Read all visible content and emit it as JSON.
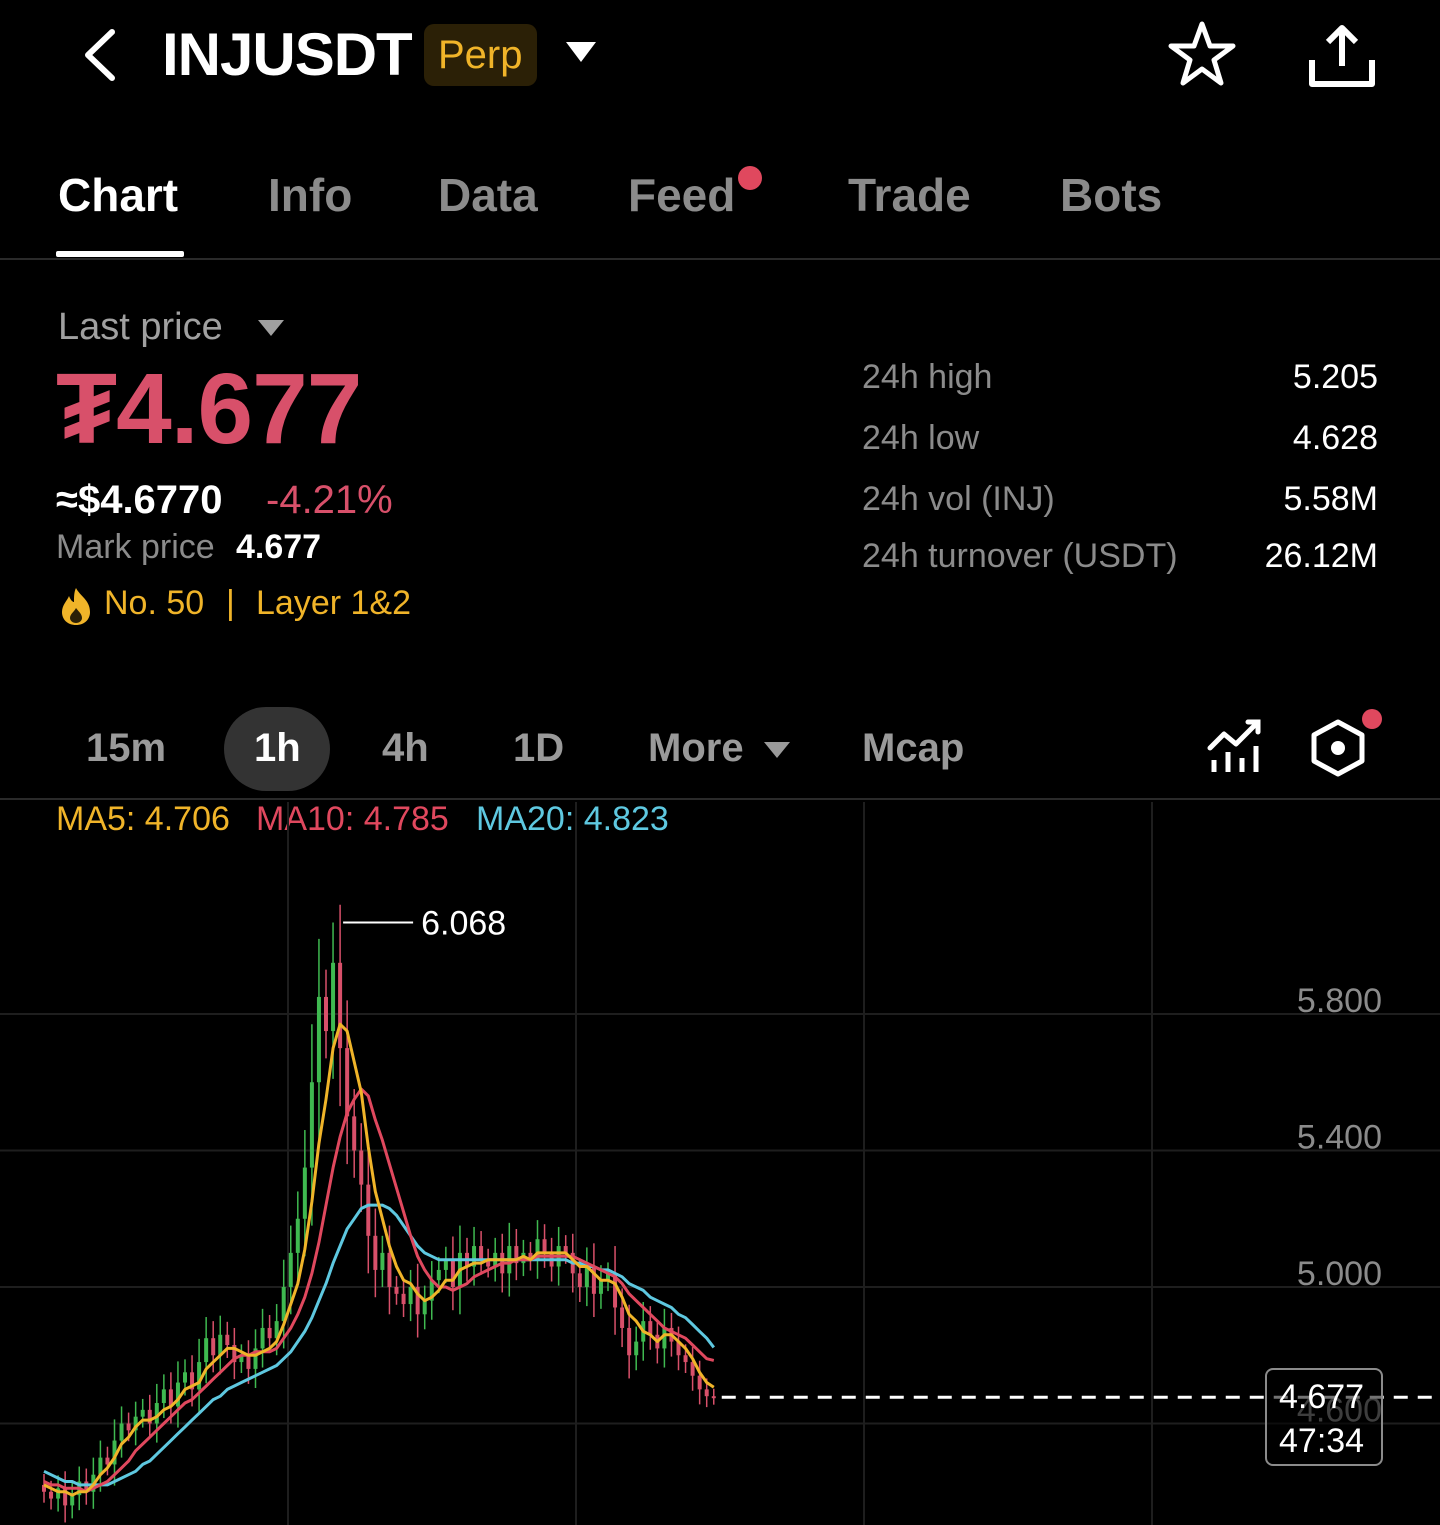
{
  "header": {
    "symbol": "INJUSDT",
    "badge": "Perp"
  },
  "tabs": [
    {
      "label": "Chart",
      "active": true
    },
    {
      "label": "Info"
    },
    {
      "label": "Data"
    },
    {
      "label": "Feed",
      "notification": true
    },
    {
      "label": "Trade"
    },
    {
      "label": "Bots"
    }
  ],
  "price": {
    "label": "Last price",
    "last": "₮4.677",
    "usd": "≈$4.6770",
    "change": "-4.21%",
    "mark_label": "Mark price",
    "mark_value": "4.677",
    "rank": "No. 50",
    "separator": "|",
    "sector": "Layer 1&2"
  },
  "stats": [
    {
      "label": "24h high",
      "value": "5.205"
    },
    {
      "label": "24h low",
      "value": "4.628"
    },
    {
      "label": "24h vol (INJ)",
      "value": "5.58M"
    },
    {
      "label": "24h turnover (USDT)",
      "value": "26.12M"
    }
  ],
  "intervals": [
    {
      "label": "15m"
    },
    {
      "label": "1h",
      "active": true
    },
    {
      "label": "4h"
    },
    {
      "label": "1D"
    },
    {
      "label": "More"
    },
    {
      "label": "Mcap"
    }
  ],
  "ma": {
    "ma5": "MA5: 4.706",
    "ma10": "MA10: 4.785",
    "ma20": "MA20: 4.823"
  },
  "colors": {
    "accent_red": "#d8506a",
    "accent_green": "#3fb950",
    "ma5": "#f0b429",
    "ma10": "#e0485e",
    "ma20": "#5ec8e0",
    "badge_bg": "#2b2006",
    "badge_fg": "#f0b429"
  },
  "chart_data": {
    "type": "candlestick",
    "y_ticks": [
      "5.800",
      "5.400",
      "5.000",
      "4.600"
    ],
    "high_label": "6.068",
    "current_price": "4.677",
    "countdown": "47:34",
    "close": [
      4.4,
      4.38,
      4.41,
      4.36,
      4.39,
      4.43,
      4.4,
      4.45,
      4.5,
      4.48,
      4.55,
      4.6,
      4.58,
      4.62,
      4.64,
      4.6,
      4.66,
      4.7,
      4.65,
      4.72,
      4.75,
      4.7,
      4.78,
      4.85,
      4.8,
      4.86,
      4.83,
      4.78,
      4.8,
      4.76,
      4.82,
      4.88,
      4.85,
      4.9,
      5.0,
      5.1,
      5.2,
      5.35,
      5.6,
      5.85,
      5.75,
      5.95,
      5.7,
      5.5,
      5.4,
      5.3,
      5.15,
      5.05,
      5.1,
      5.0,
      4.98,
      4.95,
      5.0,
      4.92,
      4.96,
      5.02,
      5.05,
      5.08,
      5.0,
      5.1,
      5.06,
      5.12,
      5.08,
      5.06,
      5.1,
      5.04,
      5.12,
      5.07,
      5.1,
      5.08,
      5.14,
      5.1,
      5.06,
      5.12,
      5.1,
      5.04,
      5.0,
      5.06,
      4.98,
      5.02,
      5.04,
      4.94,
      4.88,
      4.8,
      4.84,
      4.9,
      4.86,
      4.82,
      4.88,
      4.84,
      4.8,
      4.78,
      4.74,
      4.7,
      4.68,
      4.677
    ],
    "ma5": [
      4.42,
      4.41,
      4.4,
      4.4,
      4.39,
      4.4,
      4.4,
      4.42,
      4.45,
      4.47,
      4.5,
      4.54,
      4.56,
      4.59,
      4.61,
      4.61,
      4.62,
      4.64,
      4.65,
      4.67,
      4.7,
      4.71,
      4.72,
      4.76,
      4.78,
      4.8,
      4.82,
      4.82,
      4.81,
      4.8,
      4.8,
      4.81,
      4.82,
      4.84,
      4.89,
      4.95,
      5.01,
      5.11,
      5.25,
      5.42,
      5.55,
      5.7,
      5.77,
      5.75,
      5.66,
      5.57,
      5.41,
      5.28,
      5.2,
      5.12,
      5.06,
      5.02,
      5.01,
      4.98,
      4.96,
      4.97,
      4.99,
      5.02,
      5.02,
      5.05,
      5.06,
      5.07,
      5.07,
      5.08,
      5.08,
      5.08,
      5.08,
      5.08,
      5.09,
      5.08,
      5.1,
      5.1,
      5.1,
      5.1,
      5.1,
      5.08,
      5.06,
      5.06,
      5.04,
      5.02,
      5.02,
      5.01,
      4.97,
      4.92,
      4.9,
      4.87,
      4.86,
      4.84,
      4.86,
      4.86,
      4.84,
      4.82,
      4.79,
      4.75,
      4.72,
      4.706
    ],
    "ma10": [
      4.43,
      4.42,
      4.42,
      4.41,
      4.41,
      4.41,
      4.4,
      4.41,
      4.42,
      4.43,
      4.45,
      4.47,
      4.49,
      4.52,
      4.54,
      4.56,
      4.58,
      4.6,
      4.62,
      4.64,
      4.66,
      4.67,
      4.69,
      4.71,
      4.73,
      4.75,
      4.77,
      4.79,
      4.8,
      4.8,
      4.81,
      4.81,
      4.81,
      4.82,
      4.85,
      4.88,
      4.92,
      4.97,
      5.04,
      5.13,
      5.24,
      5.35,
      5.44,
      5.51,
      5.55,
      5.58,
      5.56,
      5.49,
      5.43,
      5.36,
      5.29,
      5.22,
      5.15,
      5.09,
      5.05,
      5.02,
      5.0,
      5.0,
      4.99,
      5.0,
      5.01,
      5.03,
      5.04,
      5.05,
      5.06,
      5.07,
      5.07,
      5.08,
      5.08,
      5.08,
      5.09,
      5.09,
      5.09,
      5.09,
      5.09,
      5.09,
      5.08,
      5.07,
      5.06,
      5.05,
      5.04,
      5.03,
      5.01,
      4.98,
      4.96,
      4.94,
      4.92,
      4.9,
      4.88,
      4.87,
      4.86,
      4.85,
      4.83,
      4.81,
      4.79,
      4.785
    ],
    "ma20": [
      4.46,
      4.45,
      4.44,
      4.43,
      4.43,
      4.42,
      4.42,
      4.42,
      4.42,
      4.42,
      4.43,
      4.44,
      4.45,
      4.46,
      4.48,
      4.49,
      4.51,
      4.53,
      4.55,
      4.57,
      4.59,
      4.61,
      4.63,
      4.65,
      4.67,
      4.68,
      4.7,
      4.71,
      4.72,
      4.73,
      4.74,
      4.75,
      4.76,
      4.77,
      4.79,
      4.81,
      4.84,
      4.87,
      4.91,
      4.96,
      5.01,
      5.07,
      5.12,
      5.17,
      5.2,
      5.23,
      5.24,
      5.24,
      5.24,
      5.23,
      5.21,
      5.18,
      5.15,
      5.12,
      5.1,
      5.09,
      5.08,
      5.08,
      5.08,
      5.08,
      5.08,
      5.08,
      5.08,
      5.08,
      5.08,
      5.08,
      5.08,
      5.08,
      5.08,
      5.08,
      5.08,
      5.08,
      5.08,
      5.08,
      5.08,
      5.07,
      5.07,
      5.06,
      5.06,
      5.05,
      5.05,
      5.04,
      5.03,
      5.01,
      5.0,
      4.99,
      4.97,
      4.96,
      4.95,
      4.94,
      4.92,
      4.91,
      4.89,
      4.87,
      4.85,
      4.823
    ]
  }
}
